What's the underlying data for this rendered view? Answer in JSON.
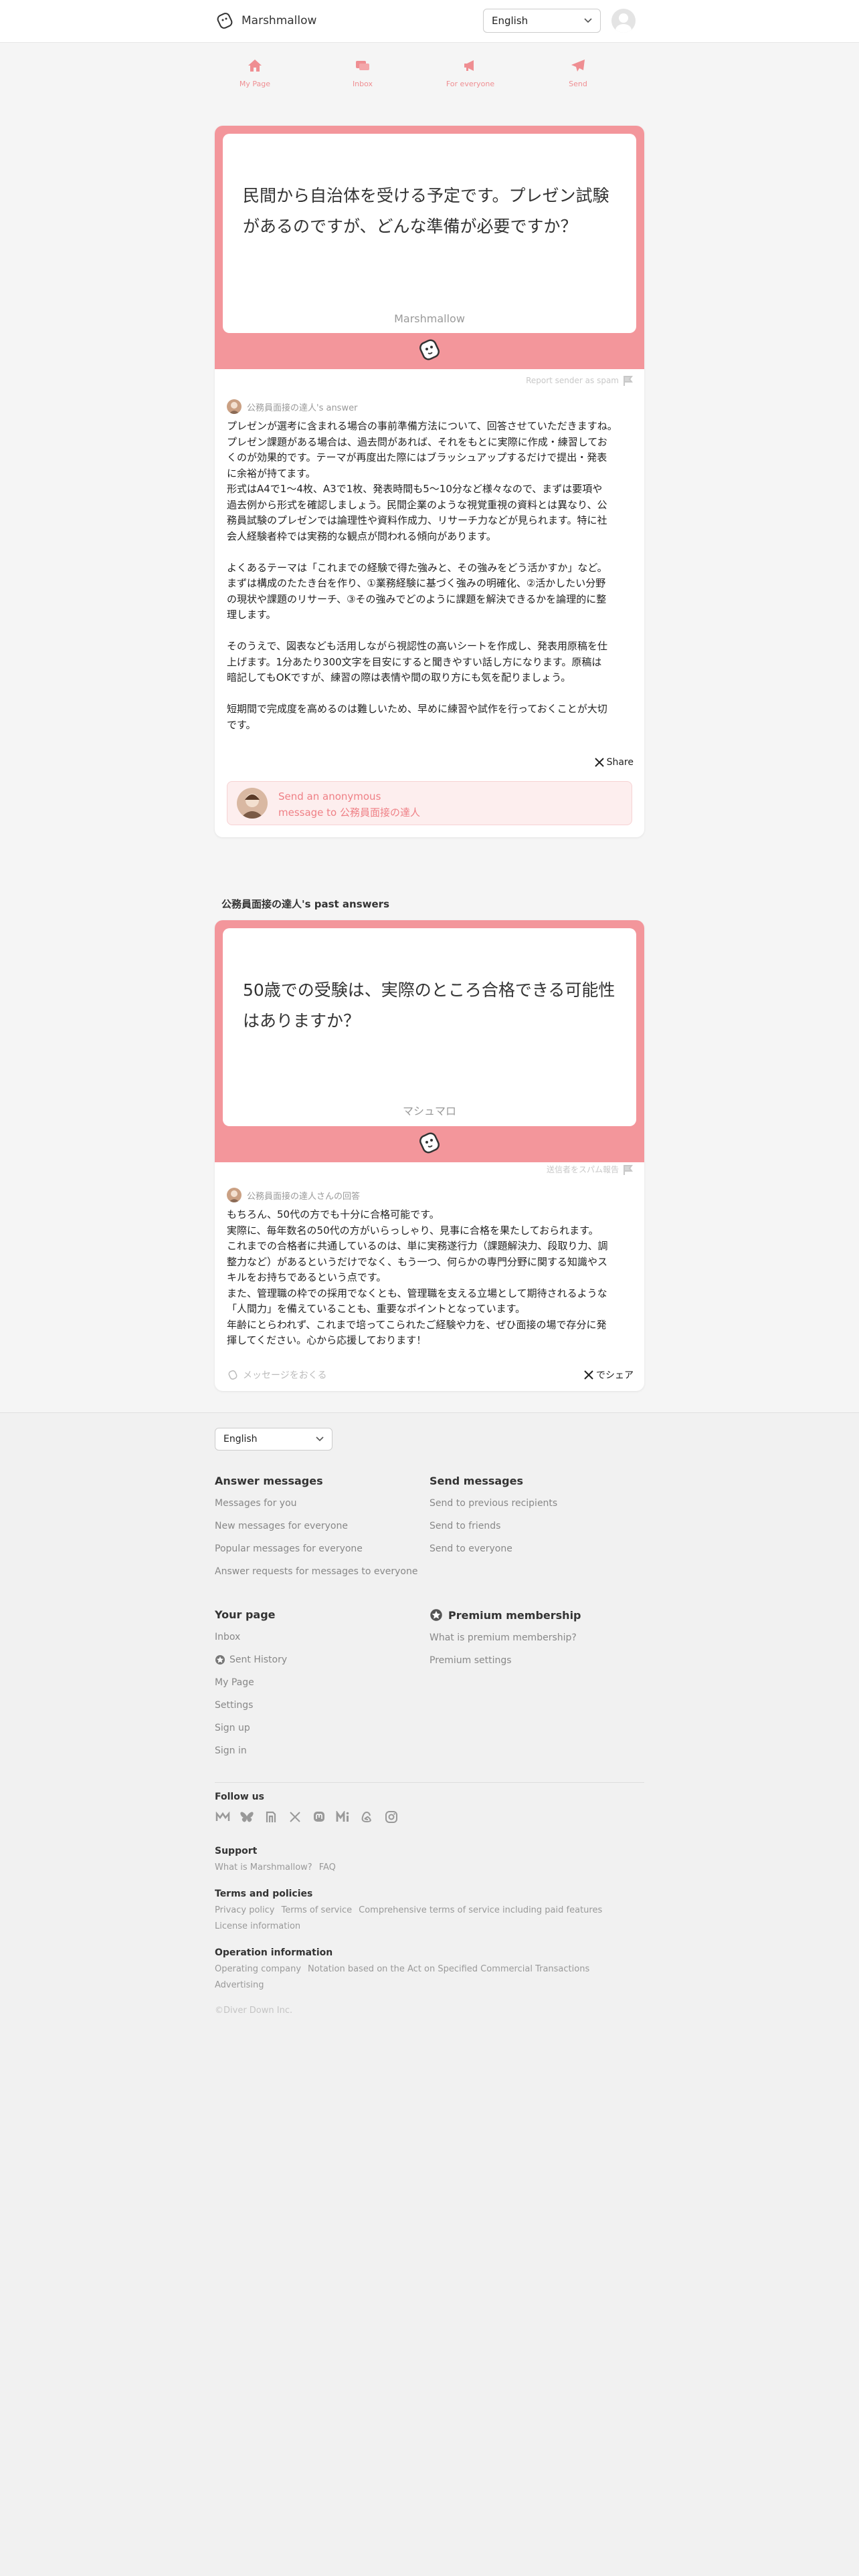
{
  "header": {
    "brand": "Marshmallow",
    "language": "English"
  },
  "nav": [
    {
      "label": "My Page",
      "icon": "home-icon"
    },
    {
      "label": "Inbox",
      "icon": "inbox-icon"
    },
    {
      "label": "For everyone",
      "icon": "megaphone-icon"
    },
    {
      "label": "Send",
      "icon": "paper-plane-icon"
    }
  ],
  "main_card": {
    "question": "民間から自治体を受ける予定です。プレゼン試験があるのですが、どんな準備が必要ですか？",
    "brand": "Marshmallow",
    "report": "Report sender as spam",
    "answerer": "公務員面接の達人's answer",
    "answer_lines": [
      "プレゼンが選考に含まれる場合の事前準備方法について、回答させていただきますね。",
      "プレゼン課題がある場合は、過去問があれば、それをもとに実際に作成・練習してお",
      "くのが効果的です。テーマが再度出た際にはブラッシュアップするだけで提出・発表",
      "に余裕が持てます。",
      "形式はA4で1〜4枚、A3で1枚、発表時間も5〜10分など様々なので、まずは要項や",
      "過去例から形式を確認しましょう。民間企業のような視覚重視の資料とは異なり、公",
      "務員試験のプレゼンでは論理性や資料作成力、リサーチ力などが見られます。特に社",
      "会人経験者枠では実務的な観点が問われる傾向があります。",
      "",
      "よくあるテーマは「これまでの経験で得た強みと、その強みをどう活かすか」など。",
      "まずは構成のたたき台を作り、①業務経験に基づく強みの明確化、②活かしたい分野",
      "の現状や課題のリサーチ、③その強みでどのように課題を解決できるかを論理的に整",
      "理します。",
      "",
      "そのうえで、図表なども活用しながら視認性の高いシートを作成し、発表用原稿を仕",
      "上げます。1分あたり300文字を目安にすると聞きやすい話し方になります。原稿は",
      "暗記してもOKですが、練習の際は表情や間の取り方にも気を配りましょう。",
      "",
      "短期間で完成度を高めるのは難しいため、早めに練習や試作を行っておくことが大切",
      "です。"
    ],
    "share": "Share",
    "send_line1": "Send an anonymous",
    "send_line2": "message to 公務員面接の達人"
  },
  "past": {
    "title": "公務員面接の達人's past answers",
    "question": "50歳での受験は、実際のところ合格できる可能性はありますか？",
    "brand": "マシュマロ",
    "report": "送信者をスパム報告",
    "answerer": "公務員面接の達人さんの回答",
    "answer_lines": [
      "もちろん、50代の方でも十分に合格可能です。",
      "実際に、毎年数名の50代の方がいらっしゃり、見事に合格を果たしておられます。",
      "これまでの合格者に共通しているのは、単に実務遂行力（課題解決力、段取り力、調",
      "整力など）があるというだけでなく、もう一つ、何らかの専門分野に関する知識やス",
      "キルをお持ちであるという点です。",
      "また、管理職の枠での採用でなくとも、管理職を支える立場として期待されるような",
      "「人間力」を備えていることも、重要なポイントとなっています。",
      "年齢にとらわれず、これまで培ってこられたご経験や力を、ぜひ面接の場で存分に発",
      "揮してください。心から応援しております！"
    ],
    "message_link": "メッセージをおくる",
    "share": "でシェア"
  },
  "footer": {
    "language": "English",
    "answer_messages": {
      "title": "Answer messages",
      "links": [
        "Messages for you",
        "New messages for everyone",
        "Popular messages for everyone",
        "Answer requests for messages to everyone"
      ]
    },
    "send_messages": {
      "title": "Send messages",
      "links": [
        "Send to previous recipients",
        "Send to friends",
        "Send to everyone"
      ]
    },
    "your_page": {
      "title": "Your page",
      "links": [
        "Inbox",
        "Sent History",
        "My Page",
        "Settings",
        "Sign up",
        "Sign in"
      ]
    },
    "premium": {
      "title": "Premium membership",
      "links": [
        "What is premium membership?",
        "Premium settings"
      ]
    },
    "follow_us": "Follow us",
    "support": {
      "title": "Support",
      "links": [
        "What is Marshmallow?",
        "FAQ"
      ]
    },
    "terms": {
      "title": "Terms and policies",
      "row1": [
        "Privacy policy",
        "Terms of service",
        "Comprehensive terms of service including paid features"
      ],
      "row2": [
        "License information"
      ]
    },
    "operation": {
      "title": "Operation information",
      "row1": [
        "Operating company",
        "Notation based on the Act on Specified Commercial Transactions"
      ],
      "row2": [
        "Advertising"
      ]
    },
    "copyright": "©Diver Down Inc."
  }
}
